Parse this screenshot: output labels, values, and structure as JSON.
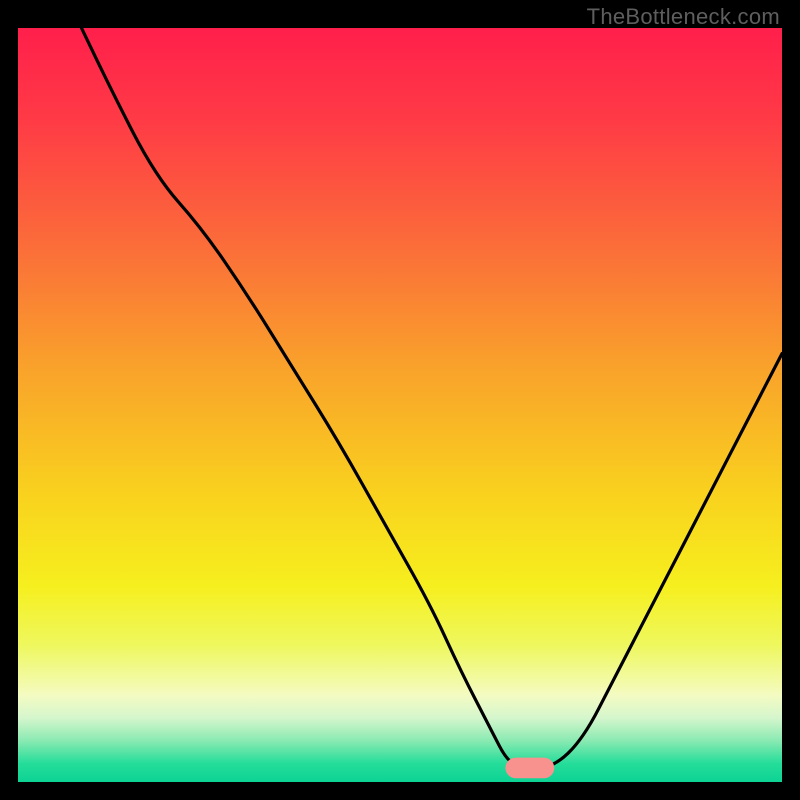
{
  "watermark": "TheBottleneck.com",
  "colors": {
    "background": "#000000",
    "curve": "#000000",
    "marker_fill": "#f7928e",
    "gradient_stops": [
      {
        "offset": 0.0,
        "color": "#ff1f4b"
      },
      {
        "offset": 0.12,
        "color": "#ff3a46"
      },
      {
        "offset": 0.28,
        "color": "#fb6a3a"
      },
      {
        "offset": 0.45,
        "color": "#f9a22b"
      },
      {
        "offset": 0.62,
        "color": "#f9d21e"
      },
      {
        "offset": 0.74,
        "color": "#f6ef1e"
      },
      {
        "offset": 0.82,
        "color": "#eef85f"
      },
      {
        "offset": 0.885,
        "color": "#f4fbc2"
      },
      {
        "offset": 0.915,
        "color": "#d5f6cd"
      },
      {
        "offset": 0.945,
        "color": "#8aeab2"
      },
      {
        "offset": 0.975,
        "color": "#26dd9a"
      },
      {
        "offset": 1.0,
        "color": "#0cd394"
      }
    ]
  },
  "chart_data": {
    "type": "line",
    "title": "",
    "xlabel": "",
    "ylabel": "",
    "xlim": [
      0,
      100
    ],
    "ylim": [
      0,
      100
    ],
    "x": [
      0,
      6,
      12,
      18,
      24,
      30,
      36,
      42,
      48,
      54,
      58,
      62,
      64,
      66,
      70,
      74,
      78,
      84,
      90,
      96,
      100
    ],
    "values": [
      118,
      105,
      92,
      80,
      73,
      64,
      54,
      44,
      33,
      22,
      13,
      5,
      1,
      0,
      0,
      4,
      12,
      24,
      36,
      48,
      56
    ],
    "marker": {
      "x": 67,
      "y": 0,
      "rx": 3.2,
      "ry": 1.4
    },
    "notes": "y is a bottleneck-percentage-like metric; curve drops from >100 at x=0 to 0 near x≈66–70 then rises; values above 100 are clipped by the plot area."
  }
}
